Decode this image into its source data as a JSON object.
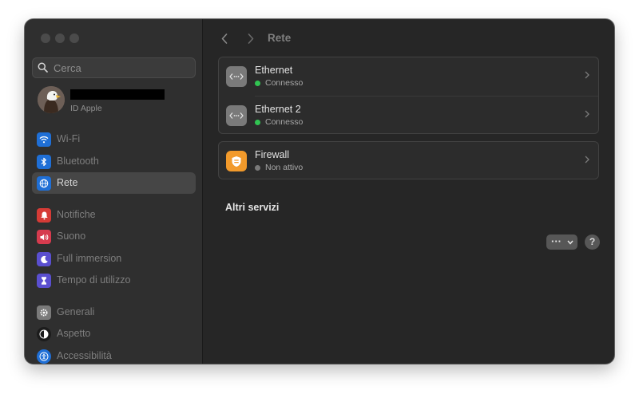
{
  "window": {
    "title": "Rete"
  },
  "search": {
    "placeholder": "Cerca"
  },
  "account": {
    "subtitle": "ID Apple"
  },
  "sidebar": {
    "items": [
      {
        "label": "Wi-Fi",
        "icon": "wifi-icon",
        "color": "#1f6fd6",
        "selected": false
      },
      {
        "label": "Bluetooth",
        "icon": "bluetooth-icon",
        "color": "#1f6fd6",
        "selected": false
      },
      {
        "label": "Rete",
        "icon": "globe-icon",
        "color": "#1f6fd6",
        "selected": true
      },
      {
        "label": "Notifiche",
        "icon": "bell-icon",
        "color": "#d63b36",
        "selected": false
      },
      {
        "label": "Suono",
        "icon": "speaker-icon",
        "color": "#d63b4e",
        "selected": false
      },
      {
        "label": "Full immersion",
        "icon": "moon-icon",
        "color": "#5a4fd0",
        "selected": false
      },
      {
        "label": "Tempo di utilizzo",
        "icon": "hourglass-icon",
        "color": "#5a4fd0",
        "selected": false
      },
      {
        "label": "Generali",
        "icon": "gear-icon",
        "color": "#7a7a7a",
        "selected": false
      },
      {
        "label": "Aspetto",
        "icon": "appearance-icon",
        "color": "#1c1c1c",
        "selected": false
      },
      {
        "label": "Accessibilità",
        "icon": "accessibility-icon",
        "color": "#1f6fd6",
        "selected": false
      }
    ]
  },
  "services": [
    {
      "name": "Ethernet",
      "status": "Connesso",
      "status_color": "#31c452",
      "icon": "ethernet-icon"
    },
    {
      "name": "Ethernet 2",
      "status": "Connesso",
      "status_color": "#31c452",
      "icon": "ethernet-icon"
    }
  ],
  "firewall": {
    "name": "Firewall",
    "status": "Non attivo",
    "status_color": "#7a7a7a",
    "icon": "firewall-icon",
    "icon_color": "#f29a2b"
  },
  "other_services": {
    "title": "Altri servizi"
  },
  "actions": {
    "more_label": "···",
    "help_label": "?"
  }
}
